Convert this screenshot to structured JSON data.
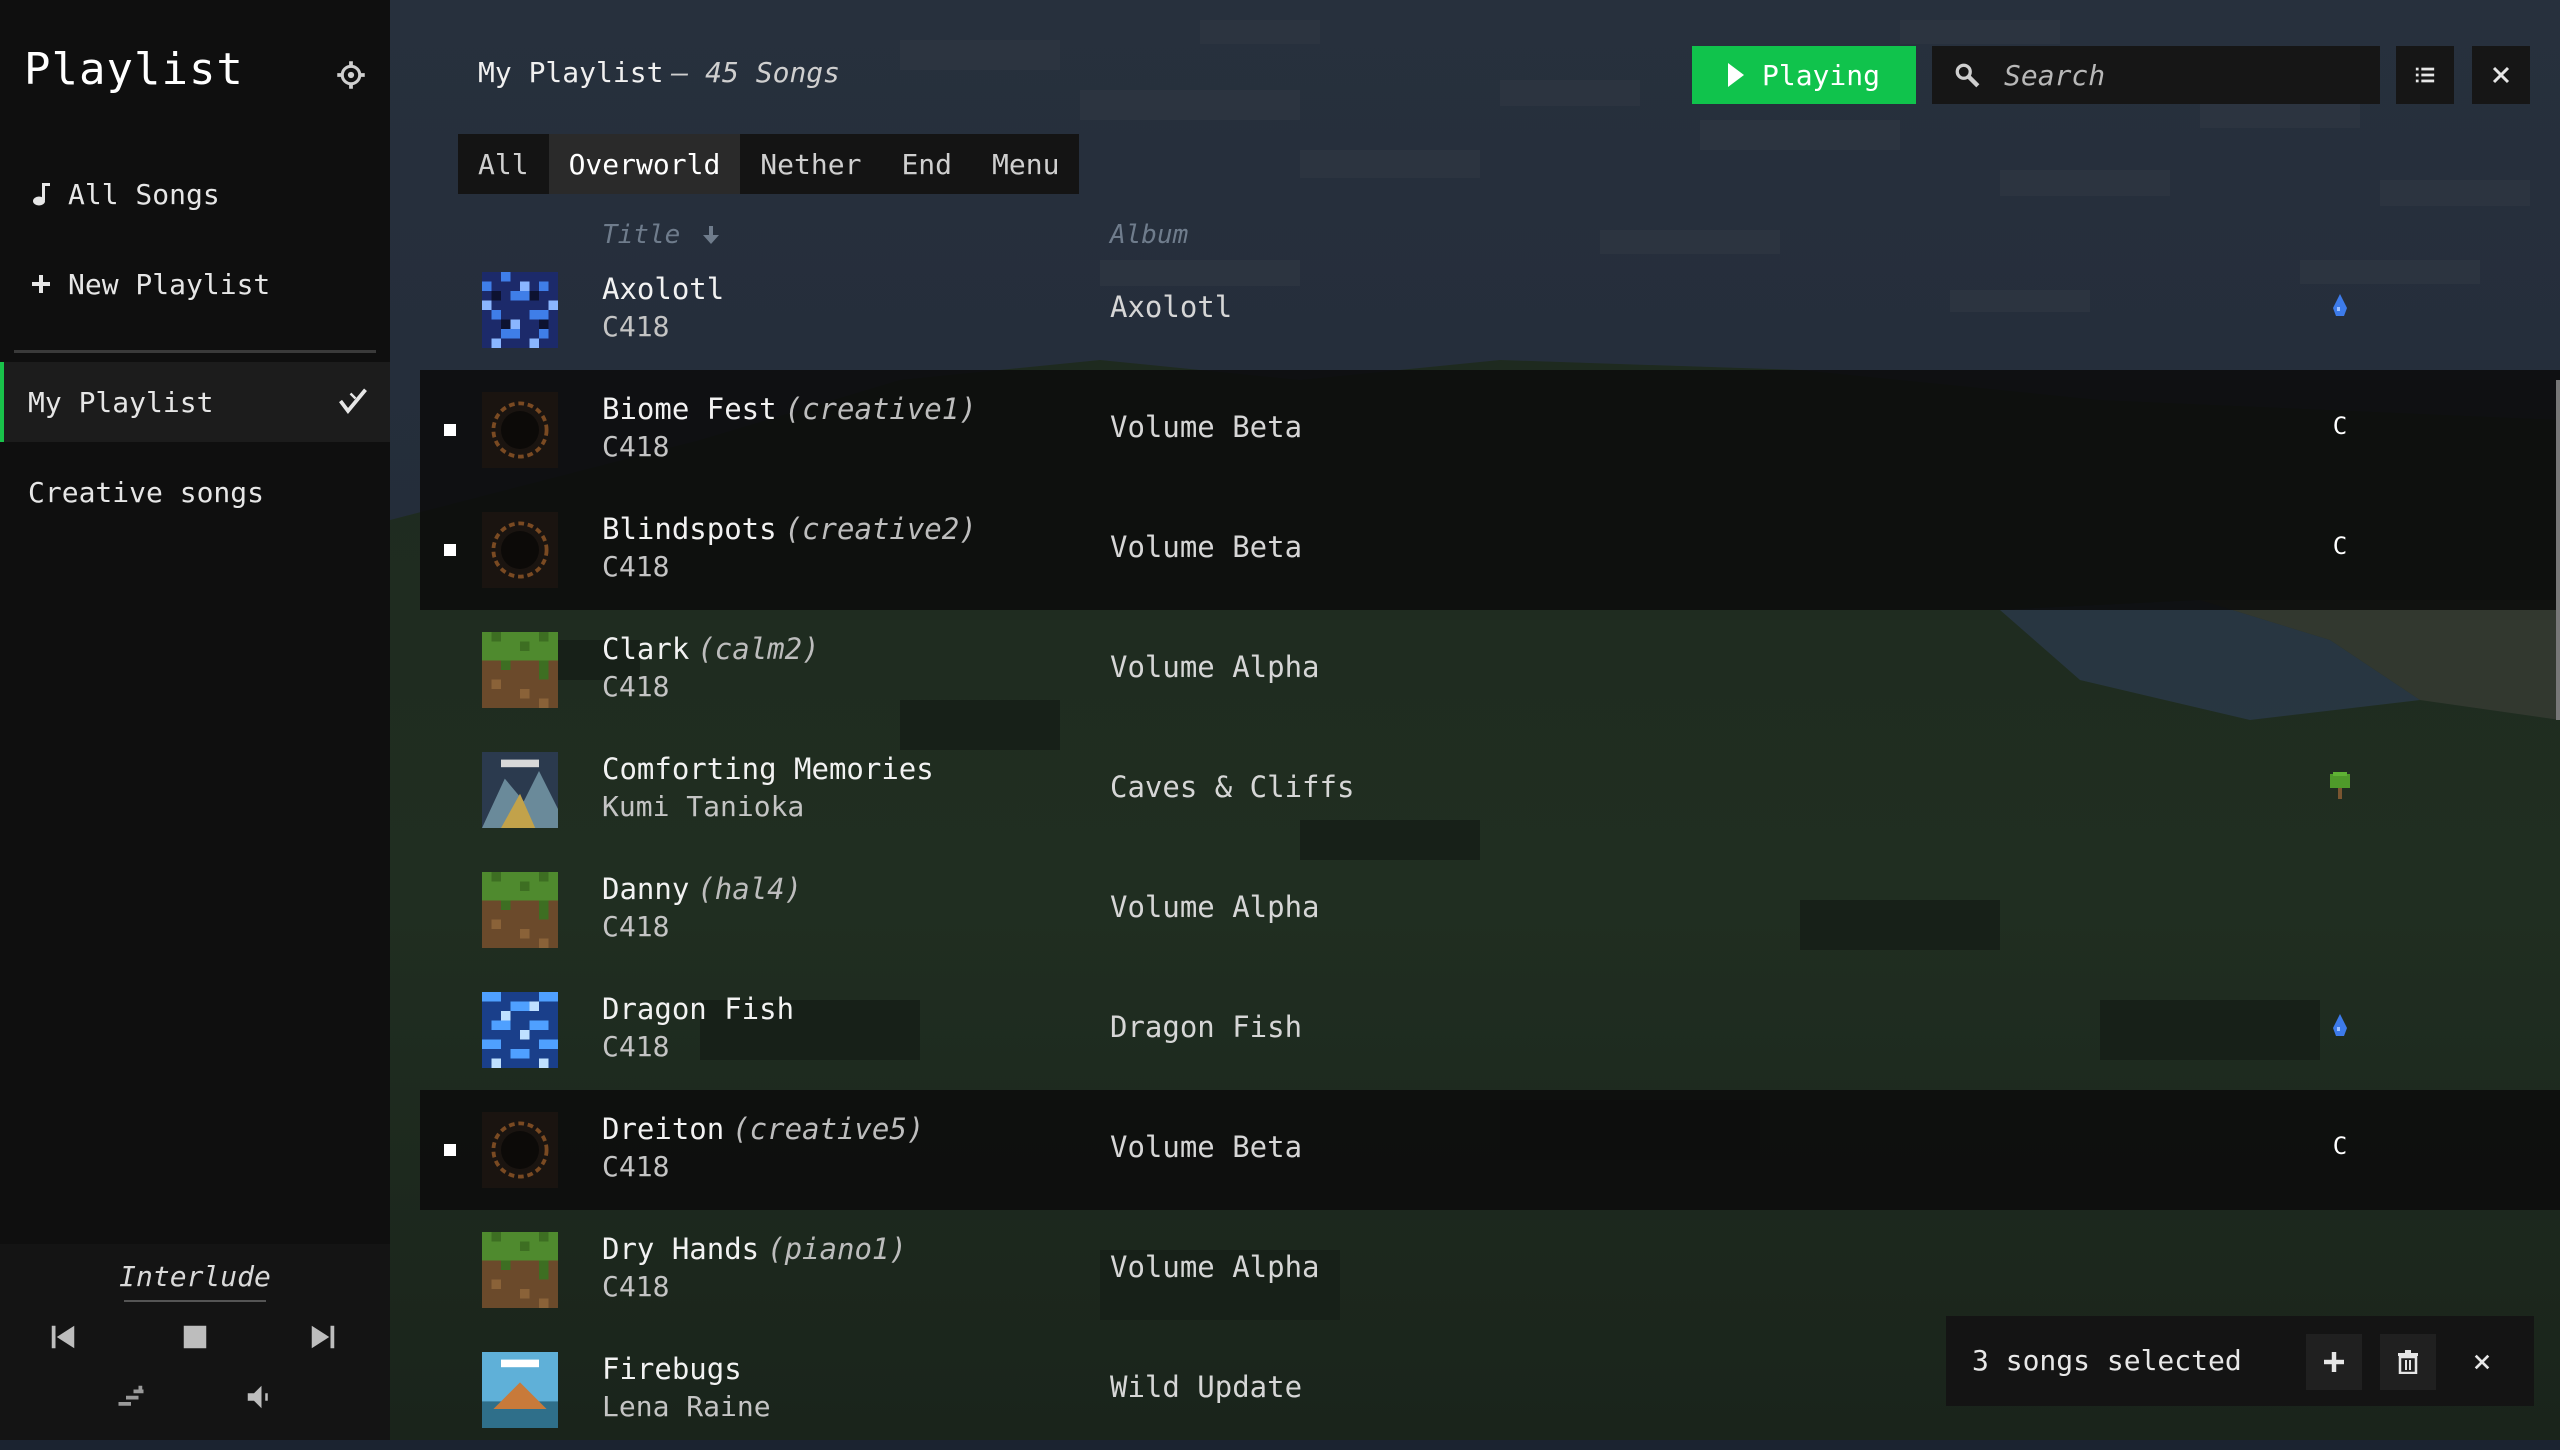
{
  "sidebar": {
    "title": "Playlist",
    "all_songs": "All Songs",
    "new_playlist": "New Playlist",
    "playlists": [
      {
        "label": "My Playlist",
        "active": true
      },
      {
        "label": "Creative songs",
        "active": false
      }
    ]
  },
  "player": {
    "now_playing": "Interlude"
  },
  "header": {
    "title": "My Playlist",
    "subtitle": "– 45 Songs",
    "playing_label": "Playing",
    "search_placeholder": "Search"
  },
  "tabs": [
    {
      "label": "All",
      "active": false
    },
    {
      "label": "Overworld",
      "active": true
    },
    {
      "label": "Nether",
      "active": false
    },
    {
      "label": "End",
      "active": false
    },
    {
      "label": "Menu",
      "active": false
    }
  ],
  "columns": {
    "title": "Title",
    "album": "Album"
  },
  "songs": [
    {
      "title": "Axolotl",
      "variant": "",
      "artist": "C418",
      "album": "Axolotl",
      "selected": false,
      "art": "blue-pixel-icon",
      "tag": "water-drop-icon",
      "tag_text": ""
    },
    {
      "title": "Biome Fest",
      "variant": "(creative1)",
      "artist": "C418",
      "album": "Volume Beta",
      "selected": true,
      "art": "dark-ring-icon",
      "tag": "creative-letter",
      "tag_text": "C"
    },
    {
      "title": "Blindspots",
      "variant": "(creative2)",
      "artist": "C418",
      "album": "Volume Beta",
      "selected": true,
      "art": "dark-ring-icon",
      "tag": "creative-letter",
      "tag_text": "C"
    },
    {
      "title": "Clark",
      "variant": "(calm2)",
      "artist": "C418",
      "album": "Volume Alpha",
      "selected": false,
      "art": "grass-block-icon",
      "tag": "",
      "tag_text": ""
    },
    {
      "title": "Comforting Memories",
      "variant": "",
      "artist": "Kumi Tanioka",
      "album": "Caves & Cliffs",
      "selected": false,
      "art": "caves-cliffs-art",
      "tag": "tree-icon",
      "tag_text": ""
    },
    {
      "title": "Danny",
      "variant": "(hal4)",
      "artist": "C418",
      "album": "Volume Alpha",
      "selected": false,
      "art": "grass-block-icon",
      "tag": "",
      "tag_text": ""
    },
    {
      "title": "Dragon Fish",
      "variant": "",
      "artist": "C418",
      "album": "Dragon Fish",
      "selected": false,
      "art": "blue-pixel-icon",
      "tag": "water-drop-icon",
      "tag_text": ""
    },
    {
      "title": "Dreiton",
      "variant": "(creative5)",
      "artist": "C418",
      "album": "Volume Beta",
      "selected": true,
      "art": "dark-ring-icon",
      "tag": "creative-letter",
      "tag_text": "C"
    },
    {
      "title": "Dry Hands",
      "variant": "(piano1)",
      "artist": "C418",
      "album": "Volume Alpha",
      "selected": false,
      "art": "grass-block-icon",
      "tag": "",
      "tag_text": ""
    },
    {
      "title": "Firebugs",
      "variant": "",
      "artist": "Lena Raine",
      "album": "Wild Update",
      "selected": false,
      "art": "wild-update-art",
      "tag": "",
      "tag_text": ""
    }
  ],
  "selection": {
    "text": "3 songs selected"
  },
  "colors": {
    "accent": "#10c34c",
    "sidebar_bg": "#0f0f0f",
    "selected_row_bg": "#0c0c0c"
  }
}
